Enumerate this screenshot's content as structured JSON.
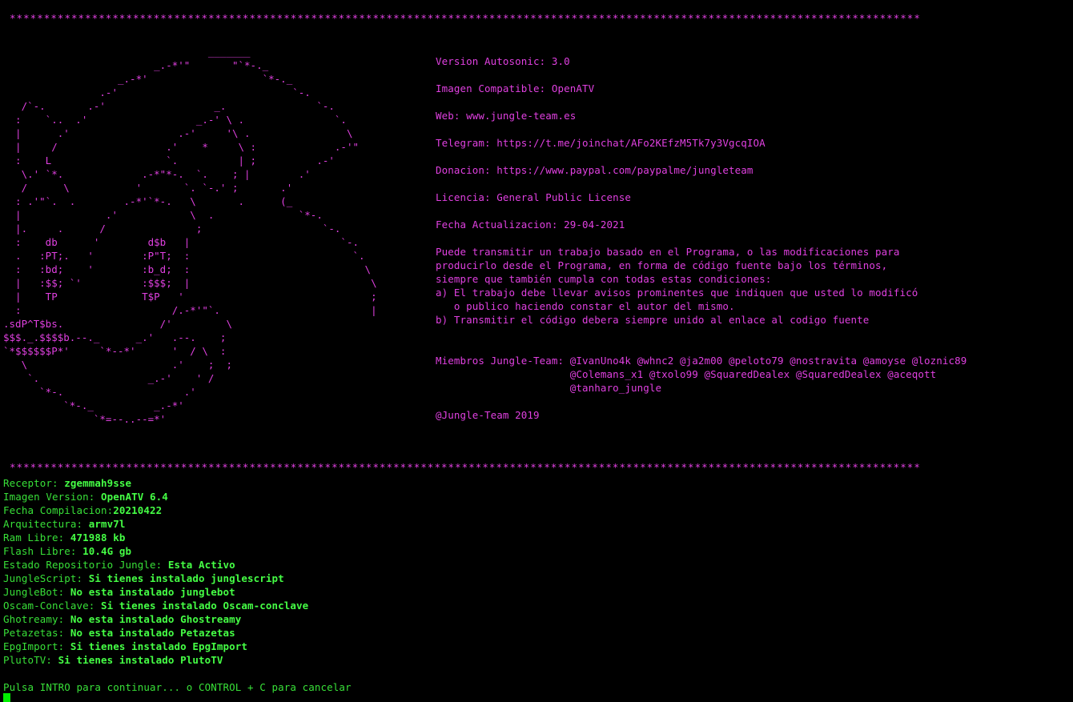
{
  "separator": "*************************************************************************************************************************************",
  "ascii_art": "                                  _______\n                         _.-*'\"       \"`*-._\n                   _.-*'                   `*-._\n                .-'                             `-.\n   /`-.       .-'                  _.               `-.\n  :    `..  .'                  _.-' \\ .               `.\n  |      .'                  .-'     '\\ .                \\\n  |     /                  .'    *     \\ :             .-'\"\n  :    L                   `.          | ;          .-'\n   \\.' `*.             .-*\"*-.  `.    ; |        .'\n   /      \\           '       `. `-.' ;       .'\n  : .'\"`.  .        .-*'`*-.   \\       .      (_\n  |              .'            \\  .              `*-.\n  |.     .      /               ;                    `-.\n  :    db      '        d$b   |                         `-.\n  .   :PT;.   '        :P\"T;  :                           `.\n  :   :bd;    '        :b_d;  :                             \\\n  |   :$$; `'          :$$$;  |                              \\\n  |    TP              T$P   '                               ;\n  :                         /.-*'\"`.                         |\n.sdP^T$bs.                /'         \\\n$$$._.$$$$b.--._      _.'   .--.    ;\n`*$$$$$$P*'     `*--*'      '  / \\  :\n   \\                        .'    ;  ;\n    `.                  _.-'    ' /\n      `*-.                    .'\n          `*-._          _.-*'\n               `*=--..--=*'",
  "info": {
    "version": "Version Autosonic: 3.0",
    "imagen": "Imagen Compatible: OpenATV",
    "web": "Web: www.jungle-team.es",
    "telegram": "Telegram: https://t.me/joinchat/AFo2KEfzM5Tk7y3VgcqIOA",
    "donacion": "Donacion: https://www.paypal.com/paypalme/jungleteam",
    "licencia": "Licencia: General Public License",
    "fecha": "Fecha Actualizacion: 29-04-2021",
    "license_text": [
      "Puede transmitir un trabajo basado en el Programa, o las modificaciones para",
      "producirlo desde el Programa, en forma de código fuente bajo los términos,",
      "siempre que también cumpla con todas estas condiciones:",
      "a) El trabajo debe llevar avisos prominentes que indiquen que usted lo modificó",
      "   o publico haciendo constar el autor del mismo.",
      "b) Transmitir el código debera siempre unido al enlace al codigo fuente"
    ],
    "miembros": [
      "Miembros Jungle-Team: @IvanUno4k @whnc2 @ja2m00 @peloto79 @nostravita @amoyse @loznic89",
      "                      @Colemans_x1 @txolo99 @SquaredDealex @SquaredDealex @aceqott",
      "                      @tanharo_jungle"
    ],
    "copyright": "@Jungle-Team 2019"
  },
  "system": {
    "receptor_label": "Receptor: ",
    "receptor_value": "zgemmah9sse",
    "imagen_label": "Imagen Version: ",
    "imagen_value": "OpenATV 6.4",
    "fecha_label": "Fecha Compilacion:",
    "fecha_value": "20210422",
    "arq_label": "Arquitectura: ",
    "arq_value": "armv7l",
    "ram_label": "Ram Libre: ",
    "ram_value": "471988 kb",
    "flash_label": "Flash Libre: ",
    "flash_value": "10.4G gb",
    "repo_label": "Estado Repositorio Jungle: ",
    "repo_value": "Esta Activo",
    "junglescript_label": "JungleScript: ",
    "junglescript_value": "Si tienes instalado junglescript",
    "junglebot_label": "JungleBot: ",
    "junglebot_value": "No esta instalado junglebot",
    "oscam_label": "Oscam-Conclave: ",
    "oscam_value": "Si tienes instalado Oscam-conclave",
    "ghostreamy_label": "Ghotreamy: ",
    "ghostreamy_value": "No esta instalado Ghostreamy",
    "petazetas_label": "Petazetas: ",
    "petazetas_value": "No esta instalado Petazetas",
    "epgimport_label": "EpgImport: ",
    "epgimport_value": "Si tienes instalado EpgImport",
    "plutotv_label": "PlutoTV: ",
    "plutotv_value": "Si tienes instalado PlutoTV"
  },
  "prompt": "Pulsa INTRO para continuar... o CONTROL + C para cancelar",
  "colors": {
    "background": "#000000",
    "magenta": "#e040e0",
    "green": "#38e038",
    "green_bright": "#45ff45"
  }
}
